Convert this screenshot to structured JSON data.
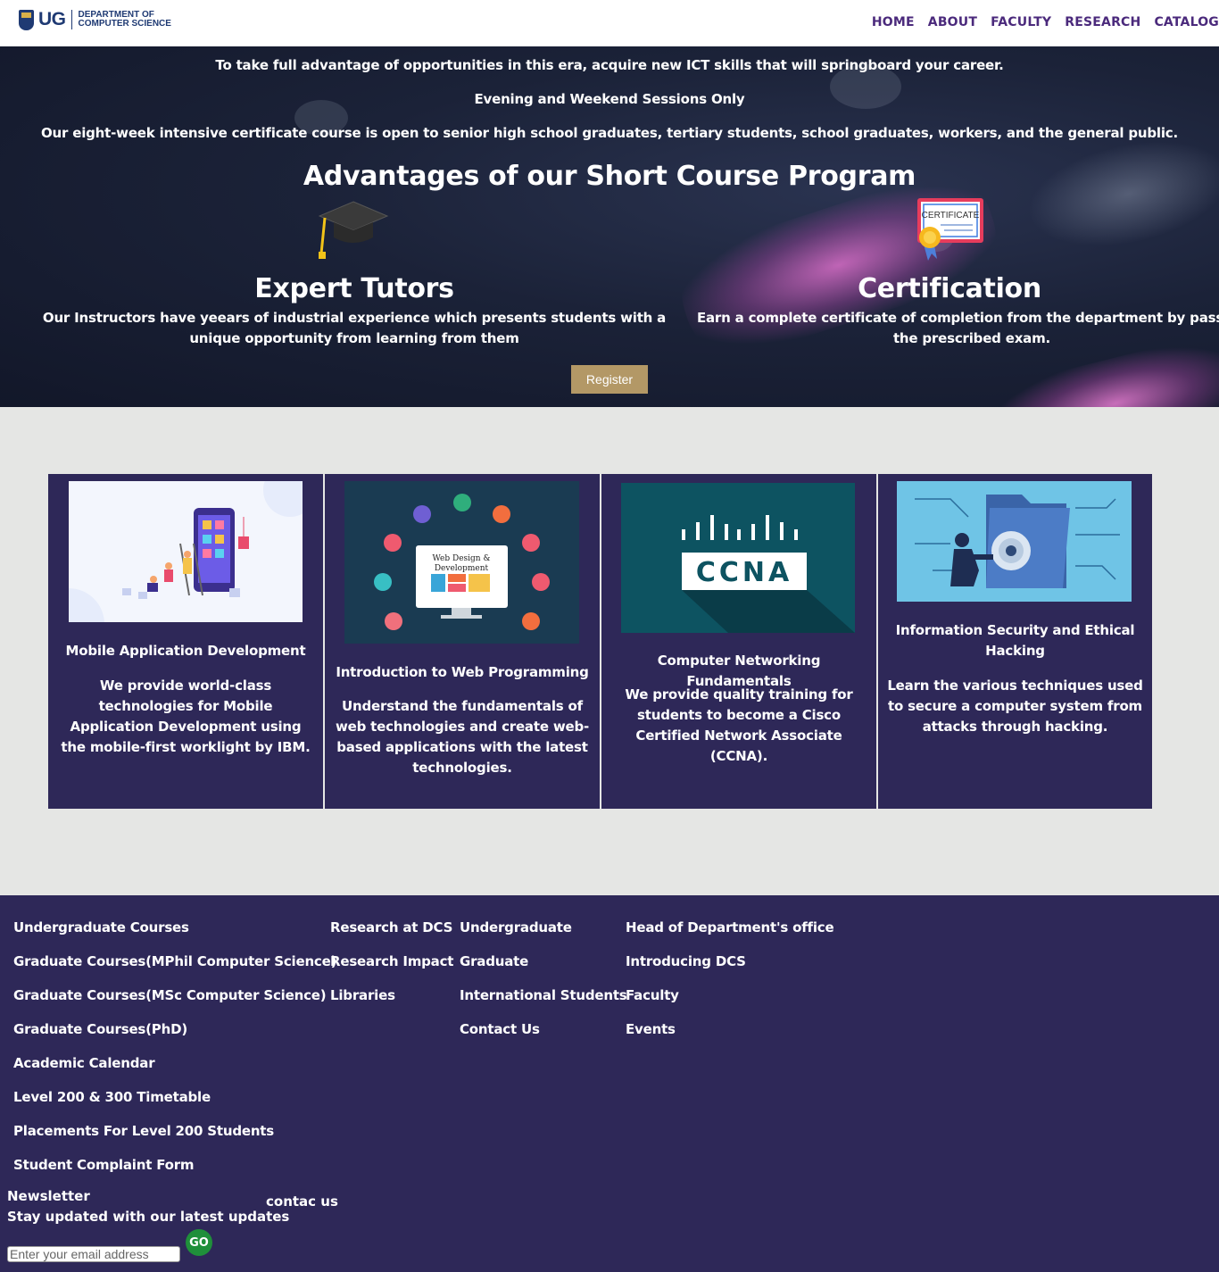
{
  "header": {
    "logo_ug": "UG",
    "logo_dept_line1": "DEPARTMENT OF",
    "logo_dept_line2": "COMPUTER SCIENCE",
    "nav": [
      "HOME",
      "ABOUT",
      "FACULTY",
      "RESEARCH",
      "CATALOG"
    ],
    "nav_color": "#4b2a7c"
  },
  "hero": {
    "line1": "To take full advantage of opportunities in this era, acquire new ICT skills that will springboard your career.",
    "line2": "Evening and Weekend Sessions Only",
    "line3": "Our eight-week intensive certificate course is open to senior high school graduates, tertiary students, school graduates, workers, and the general public.",
    "heading": "Advantages of our Short Course Program",
    "advantages": [
      {
        "icon": "graduation-cap-icon",
        "title": "Expert Tutors",
        "text": "Our Instructors have yeears of industrial experience which presents students with a unique opportunity from learning from them"
      },
      {
        "icon": "certificate-icon",
        "icon_label": "CERTIFICATE",
        "title": "Certification",
        "text": "Earn a complete certificate of completion from the department by passing the prescribed exam."
      }
    ],
    "register_label": "Register",
    "register_color": "#b39866"
  },
  "courses": [
    {
      "title": "Mobile Application Development",
      "desc": "We provide world-class technologies for Mobile Application Development using the mobile-first worklight by IBM.",
      "image": "mobile-app-illustration"
    },
    {
      "title": "Introduction to Web Programming",
      "desc": "Understand the fundamentals of web technologies and create web-based applications with the latest technologies.",
      "image": "web-design-illustration",
      "image_label_1": "Web Design &",
      "image_label_2": "Development"
    },
    {
      "title": "Computer Networking Fundamentals",
      "desc": "We provide quality training for students to become a Cisco Certified Network Associate (CCNA).",
      "image": "ccna-logo",
      "image_label": "CCNA"
    },
    {
      "title": "Information Security and Ethical Hacking",
      "desc": "Learn the various techniques used to secure a computer system from attacks through hacking.",
      "image": "security-illustration"
    }
  ],
  "footer": {
    "col1": [
      "Undergraduate Courses",
      "Graduate Courses(MPhil Computer Science)",
      "Graduate Courses(MSc Computer Science)",
      "Graduate Courses(PhD)",
      "Academic Calendar",
      "Level 200 & 300 Timetable",
      "Placements For Level 200 Students",
      "Student Complaint Form"
    ],
    "col2": [
      "Research at DCS",
      "Research Impact",
      "Libraries"
    ],
    "col3": [
      "Undergraduate",
      "Graduate",
      "International Students",
      "Contact Us"
    ],
    "col4": [
      "Head of Department's office",
      "Introducing DCS",
      "Faculty",
      "Events"
    ],
    "newsletter_title": "Newsletter",
    "newsletter_text": "Stay updated with our latest updates",
    "contact_label": "contac us",
    "email_placeholder": "Enter your email address",
    "go_label": "GO",
    "bg_color": "#2e2858"
  }
}
